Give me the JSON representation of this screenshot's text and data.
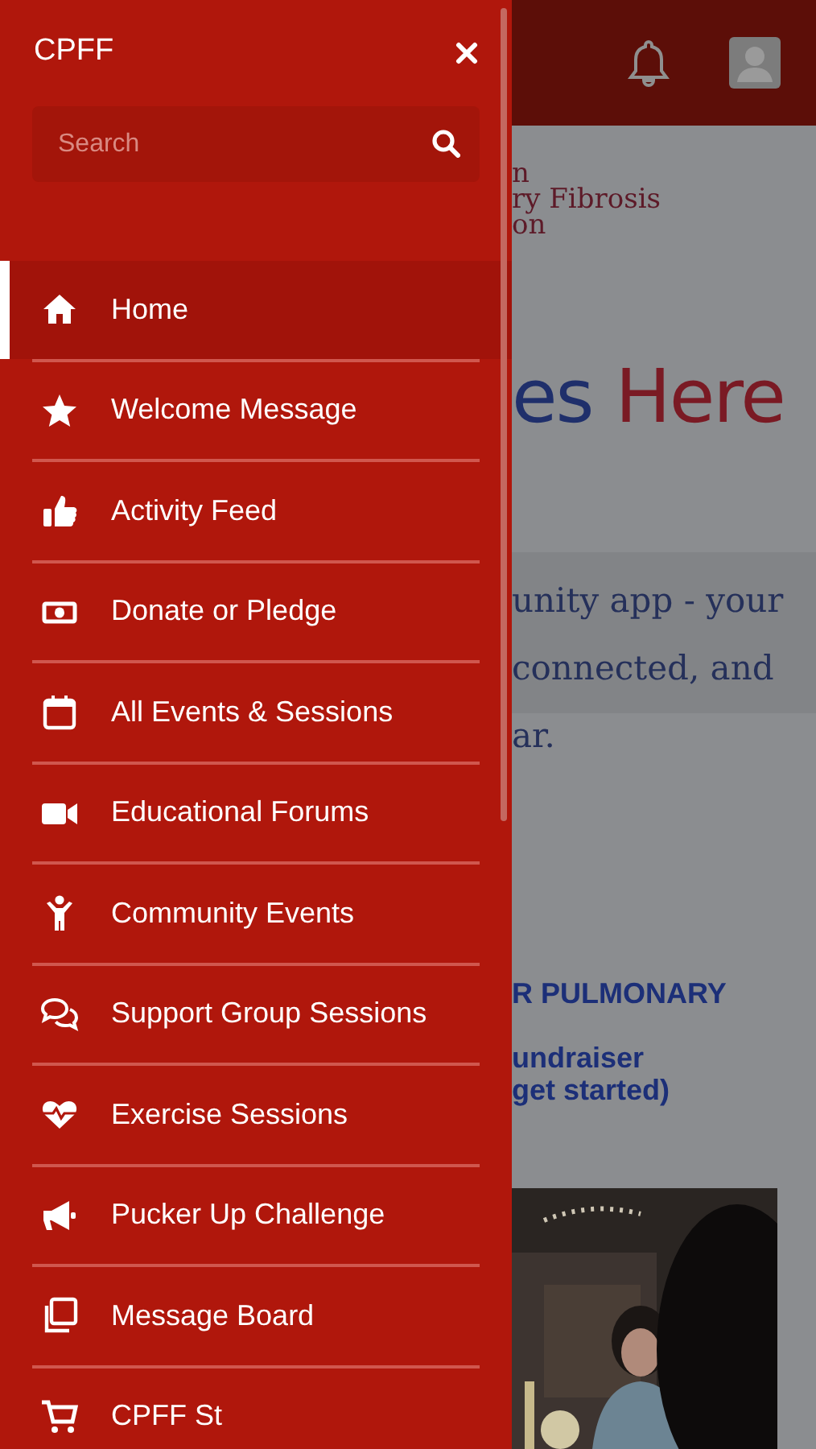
{
  "drawer": {
    "title": "CPFF",
    "search": {
      "placeholder": "Search"
    },
    "items": [
      {
        "label": "Home",
        "selected": true
      },
      {
        "label": "Welcome Message",
        "selected": false
      },
      {
        "label": "Activity Feed",
        "selected": false
      },
      {
        "label": "Donate or Pledge",
        "selected": false
      },
      {
        "label": "All Events & Sessions",
        "selected": false
      },
      {
        "label": "Educational Forums",
        "selected": false
      },
      {
        "label": "Community Events",
        "selected": false
      },
      {
        "label": "Support Group Sessions",
        "selected": false
      },
      {
        "label": "Exercise Sessions",
        "selected": false
      },
      {
        "label": "Pucker Up Challenge",
        "selected": false
      },
      {
        "label": "Message Board",
        "selected": false
      },
      {
        "label": "CPFF St",
        "selected": false
      }
    ]
  },
  "page": {
    "logo_lines": [
      "n",
      "ry Fibrosis",
      "on"
    ],
    "banner": [
      "es",
      "Here"
    ],
    "intro_lines": [
      "unity app - your",
      "connected, and",
      "ar."
    ],
    "heading": "R PULMONARY",
    "sublines": [
      "undraiser",
      "get started)"
    ]
  }
}
